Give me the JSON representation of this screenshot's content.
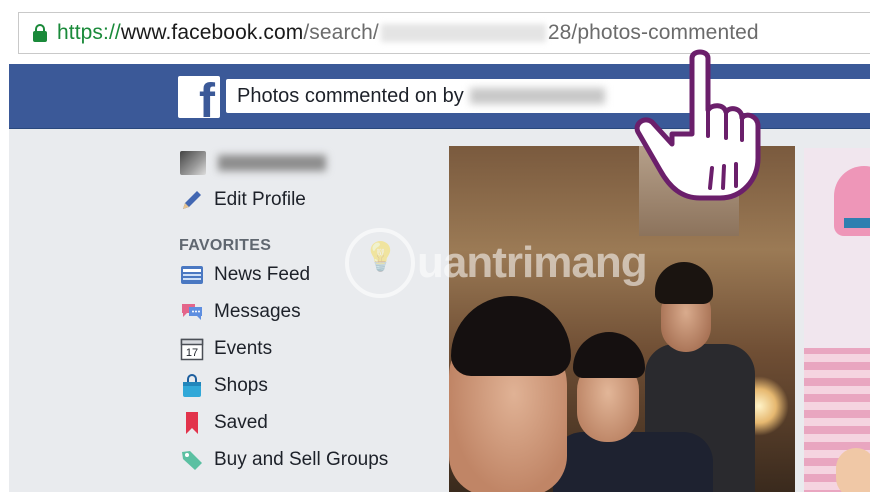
{
  "browser": {
    "url_scheme": "https://",
    "url_host": "www.facebook.com",
    "url_path_start": "/search/",
    "url_path_end": "28/photos-commented"
  },
  "header": {
    "logo": "f",
    "search_query": "Photos commented on by"
  },
  "sidebar": {
    "edit_profile": "Edit Profile",
    "favorites_heading": "FAVORITES",
    "items": [
      {
        "label": "News Feed",
        "icon": "news-feed-icon"
      },
      {
        "label": "Messages",
        "icon": "messages-icon"
      },
      {
        "label": "Events",
        "icon": "calendar-icon",
        "day": "17"
      },
      {
        "label": "Shops",
        "icon": "shopping-bag-icon"
      },
      {
        "label": "Saved",
        "icon": "bookmark-icon"
      },
      {
        "label": "Buy and Sell Groups",
        "icon": "price-tag-icon"
      }
    ]
  },
  "watermark": {
    "text": "uantrimang"
  },
  "colors": {
    "facebook_blue": "#3b5998",
    "secure_green": "#1a8a3a",
    "sidebar_bg": "#e9ebee",
    "cursor_stroke": "#6b1f6b"
  }
}
